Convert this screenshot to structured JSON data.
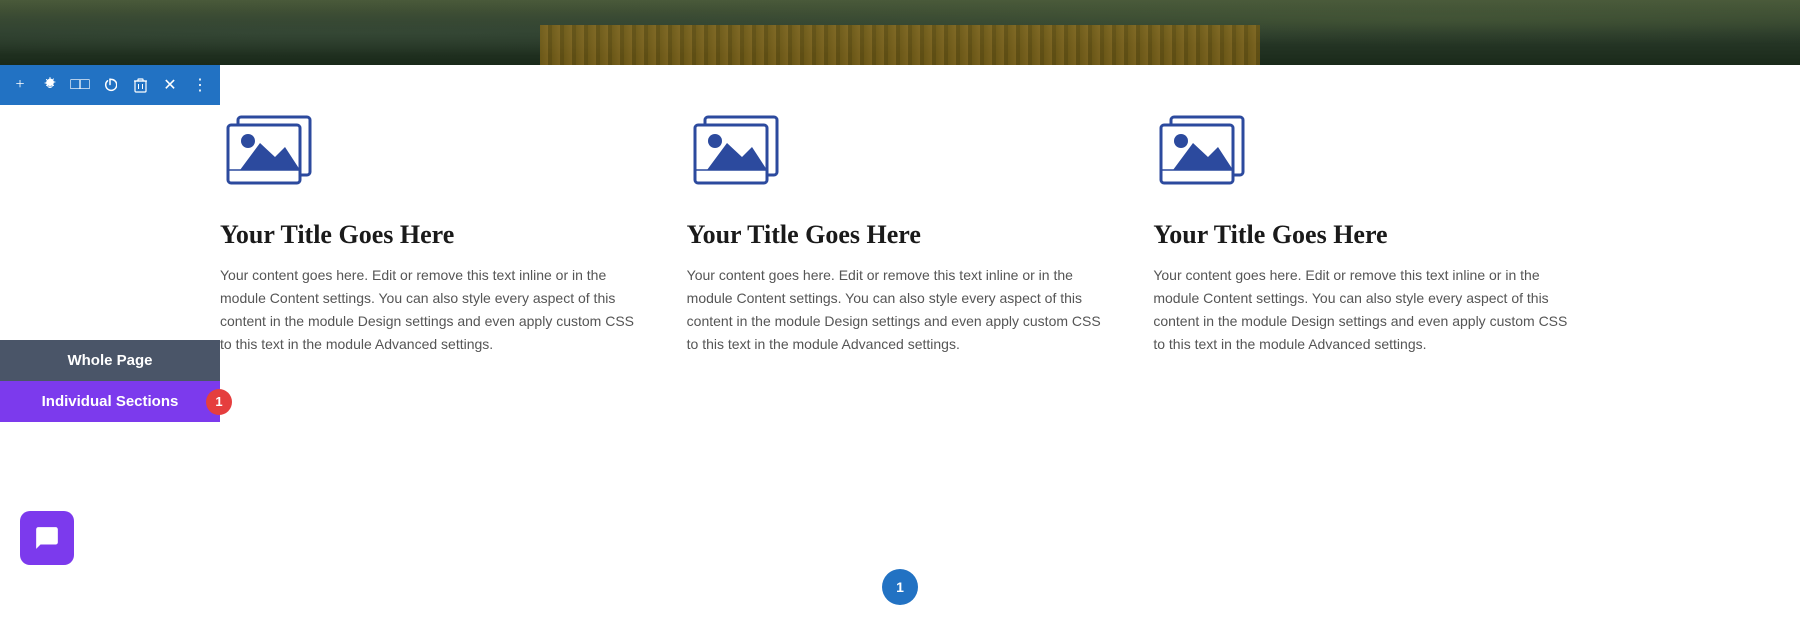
{
  "banner": {
    "alt": "Scenic bridge landscape"
  },
  "toolbar": {
    "icons": [
      {
        "name": "add-icon",
        "symbol": "+"
      },
      {
        "name": "settings-icon",
        "symbol": "✦"
      },
      {
        "name": "duplicate-icon",
        "symbol": "⧉"
      },
      {
        "name": "power-icon",
        "symbol": "⏻"
      },
      {
        "name": "trash-icon",
        "symbol": "🗑"
      },
      {
        "name": "close-icon",
        "symbol": "✕"
      },
      {
        "name": "more-icon",
        "symbol": "⋮"
      }
    ]
  },
  "columns": [
    {
      "title": "Your Title Goes Here",
      "text": "Your content goes here. Edit or remove this text inline or in the module Content settings. You can also style every aspect of this content in the module Design settings and even apply custom CSS to this text in the module Advanced settings."
    },
    {
      "title": "Your Title Goes Here",
      "text": "Your content goes here. Edit or remove this text inline or in the module Content settings. You can also style every aspect of this content in the module Design settings and even apply custom CSS to this text in the module Advanced settings."
    },
    {
      "title": "Your Title Goes Here",
      "text": "Your content goes here. Edit or remove this text inline or in the module Content settings. You can also style every aspect of this content in the module Design settings and even apply custom CSS to this text in the module Advanced settings."
    }
  ],
  "side_panel": {
    "whole_page_label": "Whole Page",
    "individual_sections_label": "Individual Sections",
    "badge_count": "1"
  },
  "pagination": {
    "current": "1"
  }
}
